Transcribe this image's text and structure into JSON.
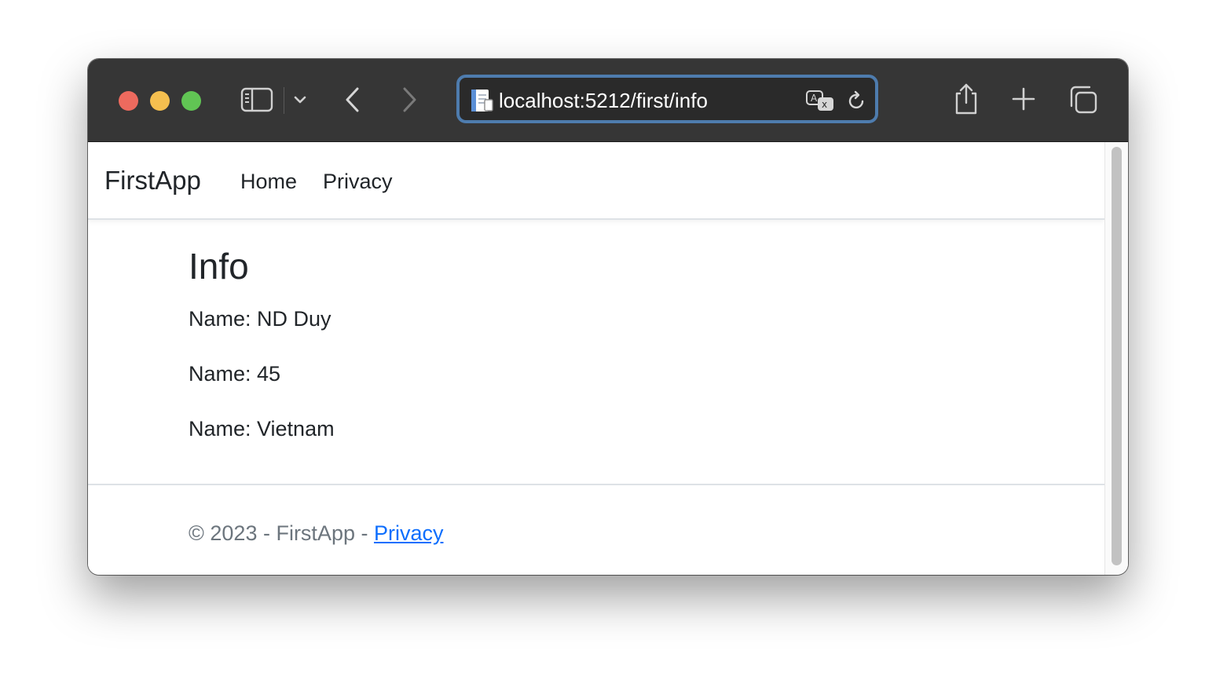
{
  "browser": {
    "url": "localhost:5212/first/info",
    "icons": {
      "sidebar": "sidebar-icon",
      "chevron": "chevron-down-icon",
      "back": "back-arrow-icon",
      "forward": "forward-arrow-icon",
      "page": "page-icon",
      "translate": "translate-icon",
      "reload": "reload-icon",
      "share": "share-icon",
      "new_tab": "plus-icon",
      "tab_overview": "tabs-overview-icon"
    },
    "colors": {
      "toolbar": "#363636",
      "address_focus_ring": "#4e7cae",
      "close": "#ed6a5e",
      "minimize": "#f5bf4f",
      "maximize": "#61c554"
    }
  },
  "navbar": {
    "brand": "FirstApp",
    "links": [
      "Home",
      "Privacy"
    ]
  },
  "main": {
    "title": "Info",
    "lines": [
      "Name: ND Duy",
      "Name: 45",
      "Name: Vietnam"
    ]
  },
  "footer": {
    "copyright": "© 2023 - FirstApp - ",
    "link": "Privacy",
    "colors": {
      "text": "#6c757d",
      "link": "#0d6efd"
    }
  }
}
